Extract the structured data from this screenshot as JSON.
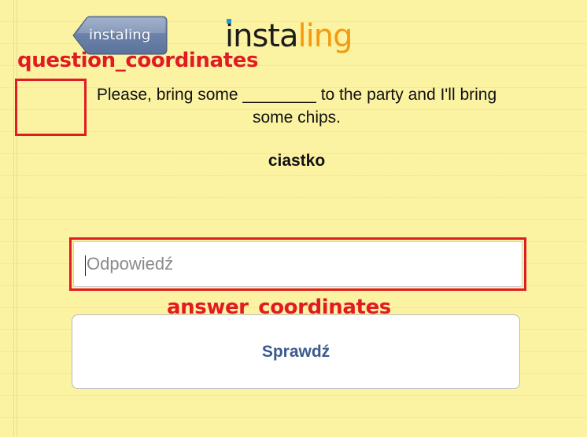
{
  "header": {
    "back_button_label": "instaling",
    "logo_part1": "insta",
    "logo_part2": "ling"
  },
  "annotations": {
    "question_label": "question_coordinates",
    "answer_label": "answer_coordinates"
  },
  "question": {
    "sentence": "Please, bring some ________ to the party and I'll bring some chips.",
    "word": "ciastko"
  },
  "answer": {
    "value": "",
    "placeholder": "Odpowiedź"
  },
  "check_button_label": "Sprawdź",
  "colors": {
    "background": "#fbf3a2",
    "logo_accent": "#f39a12",
    "annotation_red": "#e11b23",
    "button_text": "#3b5a8d",
    "back_button": "#6d84a8"
  }
}
